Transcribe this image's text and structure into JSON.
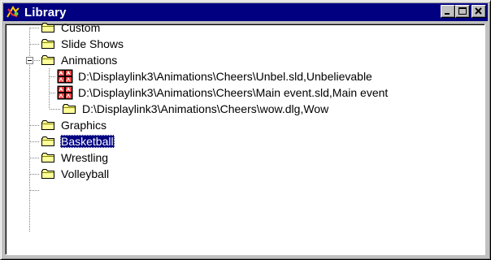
{
  "window": {
    "title": "Library",
    "icon": "library-icon"
  },
  "titlebar_buttons": [
    "minimize",
    "maximize",
    "close"
  ],
  "tree": {
    "nodes": [
      {
        "label": "Custom",
        "icon": "folder-icon",
        "depth": 0
      },
      {
        "label": "Slide Shows",
        "icon": "folder-icon",
        "depth": 0
      },
      {
        "label": "Animations",
        "icon": "folder-icon",
        "depth": 0,
        "expanded": true
      },
      {
        "label": "D:\\Displaylink3\\Animations\\Cheers\\Unbel.sld,Unbelievable",
        "icon": "film-icon",
        "depth": 1
      },
      {
        "label": "D:\\Displaylink3\\Animations\\Cheers\\Main event.sld,Main event",
        "icon": "film-icon",
        "depth": 1
      },
      {
        "label": "D:\\Displaylink3\\Animations\\Cheers\\wow.dlg,Wow",
        "icon": "folder-icon",
        "depth": 1
      },
      {
        "label": "Graphics",
        "icon": "folder-icon",
        "depth": 0
      },
      {
        "label": "Basketball",
        "icon": "folder-icon",
        "depth": 0,
        "selected": true
      },
      {
        "label": "Wrestling",
        "icon": "folder-icon",
        "depth": 0
      },
      {
        "label": "Volleyball",
        "icon": "folder-icon",
        "depth": 0
      }
    ]
  },
  "colors": {
    "titlebar": "#000080",
    "selection": "#000080",
    "folder": "#ffff99",
    "face": "#c0c0c0"
  }
}
